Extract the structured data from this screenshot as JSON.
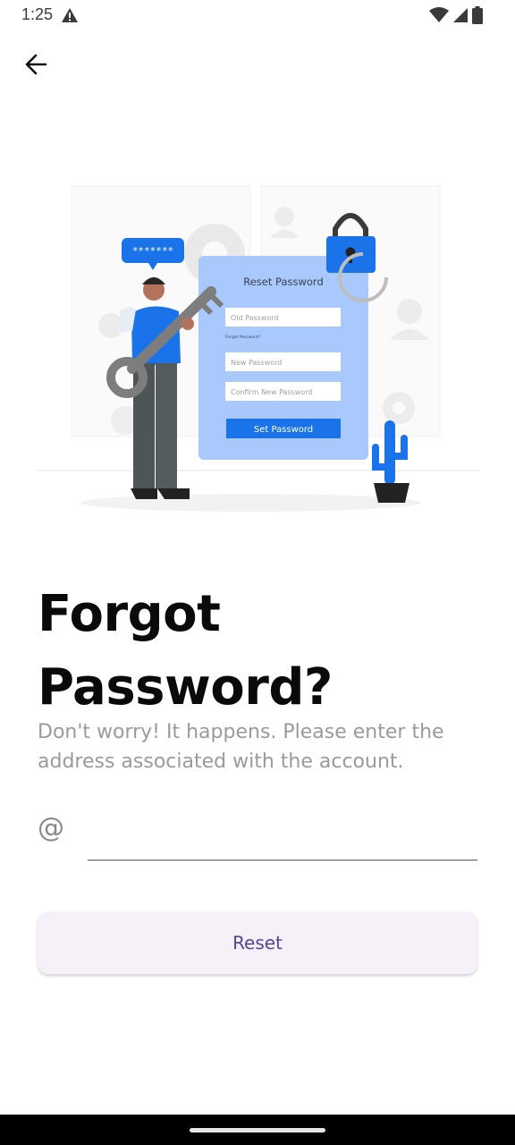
{
  "status_bar": {
    "time": "1:25",
    "icons": [
      "warning-icon",
      "wifi-icon",
      "signal-icon",
      "battery-icon"
    ]
  },
  "header": {
    "back_icon": "arrow-left-icon"
  },
  "illustration": {
    "speech_bubble": "*******",
    "card_title": "Reset Password",
    "old_password_placeholder": "Old Password",
    "forgot_link": "Forgot Password?",
    "new_password_placeholder": "New Password",
    "confirm_password_placeholder": "Confirm New Password",
    "set_password_label": "Set Password"
  },
  "main": {
    "title": "Forgot Password?",
    "subtitle": "Don't worry! It happens. Please enter the address associated with the account.",
    "email": {
      "icon_glyph": "@",
      "value": "",
      "placeholder": ""
    },
    "reset_label": "Reset"
  },
  "colors": {
    "accent_blue": "#1a73e8",
    "button_bg": "#f6f0f9",
    "button_text": "#5a4590",
    "subtitle": "#9a9a9a"
  }
}
